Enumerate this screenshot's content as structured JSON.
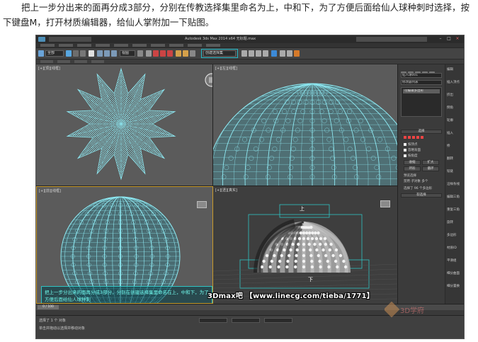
{
  "article": {
    "paragraph": "把上一步分出来的面再分成3部分，分别在传教选择集里命名为上，中和下，为了方便后面给仙人球种刺时选择，按下键盘M，打开材质编辑器，给仙人掌附加一下贴图。"
  },
  "app": {
    "title": "Autodesk 3ds Max 2014 x64     无标题.max",
    "toolbar": {
      "workspace_combo": "工作区: 默认",
      "selection_combo": "全部",
      "view_combo": "视图",
      "named_set_combo": "创建选择集"
    }
  },
  "viewports": {
    "top_left": {
      "label": "[+][顶][线框]"
    },
    "top_right": {
      "label": "[+][左][线框]"
    },
    "bottom_left": {
      "label": "[+][前][线框]"
    },
    "bottom_right": {
      "label": "[+][透][真实]"
    }
  },
  "viewport_annotation": {
    "tag_top": "上",
    "tag_bottom": "下"
  },
  "overlay": {
    "text": "把上一步分出来的面再分成3部分，分别在创建选择集里命名在上，中和下，为了方便后面给仙人球种刺"
  },
  "command_panel": {
    "name_field": "仙人球001",
    "modifier_combo": "修改器列表",
    "stack_item": "可编辑多边形",
    "rollout_selection": "选择",
    "check_vertex": "按顶点",
    "check_ignore_backface": "忽略背面",
    "check_angle": "按角度",
    "btn_shrink": "收缩",
    "btn_grow": "扩大",
    "btn_ring": "环形",
    "btn_loop": "循环",
    "preview_label": "预览选择",
    "radio_off": "禁用",
    "radio_subobj": "子对象",
    "radio_multi": "多个",
    "selected_count": "选择了 96 个多边形",
    "rollout_soft": "软选择",
    "col_items": [
      "编辑",
      "插入顶点",
      "挤出",
      "倒角",
      "轮廓",
      "插入",
      "桥",
      "翻转",
      "铰链",
      "沿样条线",
      "编辑三角",
      "重复三角",
      "旋转",
      "多边形",
      "材质ID",
      "平滑组",
      "细分曲面",
      "细分置换"
    ]
  },
  "timeline": {
    "slider": "0 / 100"
  },
  "status": {
    "line1": "选择了 1 个 对象",
    "line2": "单击并拖动以选择并移动对象"
  },
  "watermark": {
    "text": "3Dmax吧 【www.linecg.com/tieba/1771】",
    "logo_text": "3D学府"
  }
}
